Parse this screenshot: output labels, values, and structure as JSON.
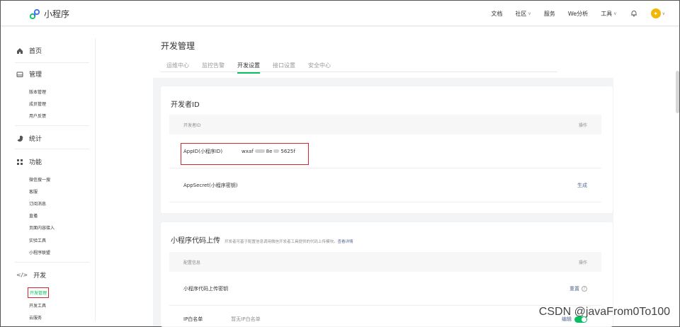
{
  "app": {
    "logo_text": "小程序"
  },
  "topnav": {
    "docs": "文档",
    "community": "社区",
    "service": "服务",
    "we_analysis": "We分析",
    "tools": "工具"
  },
  "sidebar": {
    "home": "首页",
    "manage": "管理",
    "manage_items": [
      "版本管理",
      "成员管理",
      "用户反馈"
    ],
    "stats": "统计",
    "features": "功能",
    "feature_items": [
      "微信搜一搜",
      "客服",
      "订阅消息",
      "直播",
      "页面内容接入",
      "实验工具",
      "小程序联盟"
    ],
    "dev": "开发",
    "dev_items": [
      "开发管理",
      "开发工具",
      "云服务"
    ]
  },
  "main": {
    "title": "开发管理",
    "tabs": [
      "运维中心",
      "监控告警",
      "开发设置",
      "接口设置",
      "安全中心"
    ],
    "active_tab": "开发设置",
    "developer_id": {
      "title": "开发者ID",
      "head_left": "开发者ID",
      "head_right": "操作",
      "appid_label": "AppID(小程序ID)",
      "appid_prefix": "wxaf",
      "appid_mid": "8e",
      "appid_suffix": "5625f",
      "appsecret_label": "AppSecret(小程序密钥)",
      "appsecret_action": "生成"
    },
    "code_upload": {
      "title": "小程序代码上传",
      "desc": "开发者可基于配置信息调用微信开发者工具提供的代码上传模块。",
      "desc_link": "查看详情",
      "head_left": "配置信息",
      "head_right": "操作",
      "key_label": "小程序代码上传密钥",
      "key_action": "重置",
      "ip_label": "IP白名单",
      "ip_value": "暂无IP白名单",
      "ip_action": "编辑"
    }
  },
  "watermark": "CSDN @javaFrom0To100",
  "colors": {
    "accent": "#07c160",
    "highlight": "#d9232d",
    "link": "#576b95"
  }
}
